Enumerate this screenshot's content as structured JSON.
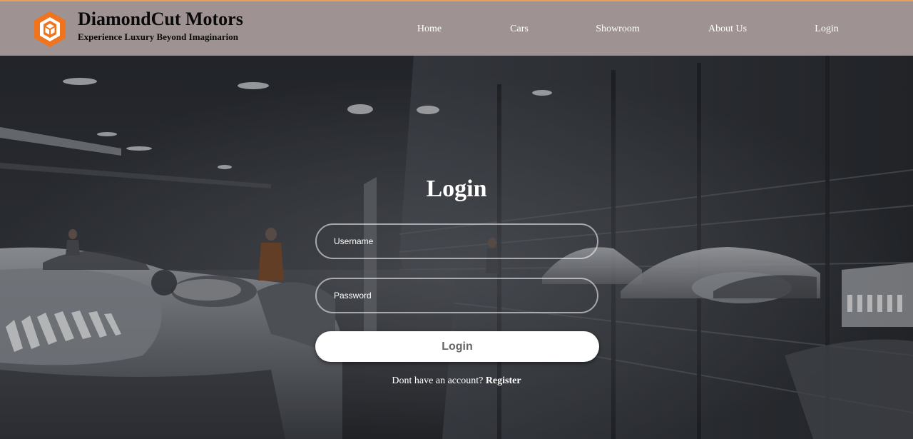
{
  "brand": {
    "name": "DiamondCut Motors",
    "tagline": "Experience Luxury Beyond Imaginarion",
    "logo_icon": "hexagon-cube-icon",
    "logo_color": "#f0731e"
  },
  "nav": {
    "items": [
      {
        "label": "Home"
      },
      {
        "label": "Cars"
      },
      {
        "label": "Showroom"
      },
      {
        "label": "About Us"
      },
      {
        "label": "Login"
      }
    ]
  },
  "form": {
    "title": "Login",
    "username_placeholder": "Username",
    "password_placeholder": "Password",
    "submit_label": "Login",
    "register_prompt": "Dont have an account?",
    "register_link": "Register"
  },
  "colors": {
    "header_bg": "#9e9292",
    "header_accent": "#e8a05a",
    "button_bg": "#ffffff",
    "button_text": "#666666"
  }
}
